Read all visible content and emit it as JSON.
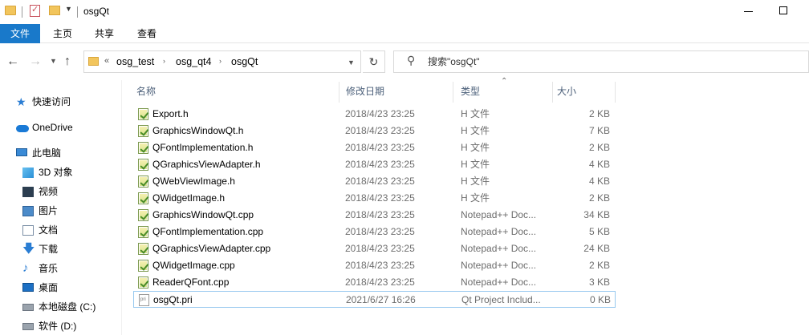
{
  "window": {
    "title": "osgQt"
  },
  "ribbon": {
    "tabs": [
      "文件",
      "主页",
      "共享",
      "查看"
    ]
  },
  "address": {
    "path": [
      "osg_test",
      "osg_qt4",
      "osgQt"
    ],
    "overflow": "«"
  },
  "search": {
    "placeholder": "搜索\"osgQt\""
  },
  "sidebar": {
    "items": [
      {
        "label": "快速访问",
        "icon": "star-icon"
      },
      {
        "label": "OneDrive",
        "icon": "cloud-icon"
      },
      {
        "label": "此电脑",
        "icon": "computer-icon"
      },
      {
        "label": "3D 对象",
        "icon": "3d-objects-icon"
      },
      {
        "label": "视频",
        "icon": "video-icon"
      },
      {
        "label": "图片",
        "icon": "pictures-icon"
      },
      {
        "label": "文档",
        "icon": "documents-icon"
      },
      {
        "label": "下载",
        "icon": "download-icon"
      },
      {
        "label": "音乐",
        "icon": "music-icon"
      },
      {
        "label": "桌面",
        "icon": "desktop-icon"
      },
      {
        "label": "本地磁盘 (C:)",
        "icon": "drive-icon"
      },
      {
        "label": "软件 (D:)",
        "icon": "drive-icon"
      }
    ]
  },
  "columns": {
    "name": "名称",
    "date": "修改日期",
    "type": "类型",
    "size": "大小"
  },
  "files": [
    {
      "name": "Export.h",
      "date": "2018/4/23 23:25",
      "type": "H 文件",
      "size": "2 KB",
      "icon": "header-file-icon"
    },
    {
      "name": "GraphicsWindowQt.h",
      "date": "2018/4/23 23:25",
      "type": "H 文件",
      "size": "7 KB",
      "icon": "header-file-icon"
    },
    {
      "name": "QFontImplementation.h",
      "date": "2018/4/23 23:25",
      "type": "H 文件",
      "size": "2 KB",
      "icon": "header-file-icon"
    },
    {
      "name": "QGraphicsViewAdapter.h",
      "date": "2018/4/23 23:25",
      "type": "H 文件",
      "size": "4 KB",
      "icon": "header-file-icon"
    },
    {
      "name": "QWebViewImage.h",
      "date": "2018/4/23 23:25",
      "type": "H 文件",
      "size": "4 KB",
      "icon": "header-file-icon"
    },
    {
      "name": "QWidgetImage.h",
      "date": "2018/4/23 23:25",
      "type": "H 文件",
      "size": "2 KB",
      "icon": "header-file-icon"
    },
    {
      "name": "GraphicsWindowQt.cpp",
      "date": "2018/4/23 23:25",
      "type": "Notepad++ Doc...",
      "size": "34 KB",
      "icon": "cpp-file-icon"
    },
    {
      "name": "QFontImplementation.cpp",
      "date": "2018/4/23 23:25",
      "type": "Notepad++ Doc...",
      "size": "5 KB",
      "icon": "cpp-file-icon"
    },
    {
      "name": "QGraphicsViewAdapter.cpp",
      "date": "2018/4/23 23:25",
      "type": "Notepad++ Doc...",
      "size": "24 KB",
      "icon": "cpp-file-icon"
    },
    {
      "name": "QWidgetImage.cpp",
      "date": "2018/4/23 23:25",
      "type": "Notepad++ Doc...",
      "size": "2 KB",
      "icon": "cpp-file-icon"
    },
    {
      "name": "ReaderQFont.cpp",
      "date": "2018/4/23 23:25",
      "type": "Notepad++ Doc...",
      "size": "3 KB",
      "icon": "cpp-file-icon"
    },
    {
      "name": "osgQt.pri",
      "date": "2021/6/27 16:26",
      "type": "Qt Project Includ...",
      "size": "0 KB",
      "icon": "pri-file-icon",
      "selected": true
    }
  ]
}
